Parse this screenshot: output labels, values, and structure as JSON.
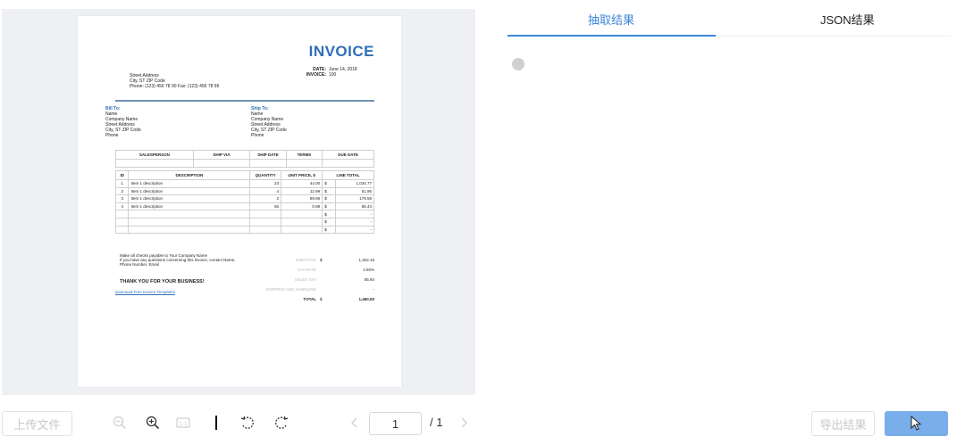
{
  "toolbar": {
    "upload_label": "上传文件",
    "page_current": "1",
    "page_total": "/ 1",
    "icons": [
      "zoom-out-icon",
      "zoom-in-icon",
      "fit-page-icon",
      "divider-icon",
      "rotate-left-icon",
      "rotate-right-icon",
      "prev-page-icon",
      "next-page-icon"
    ]
  },
  "tabs": {
    "extract": "抽取结果",
    "json": "JSON结果"
  },
  "actions": {
    "export_label": "导出结果"
  },
  "colors": {
    "accent": "#3e86d9",
    "primary_button": "#7aaeea",
    "invoice_blue": "#2f6fb5"
  },
  "invoice": {
    "title": "INVOICE",
    "date_label": "DATE:",
    "date_value": "June 14, 2018",
    "invoice_label": "INVOICE:",
    "invoice_value": "100",
    "address": [
      "Street Address",
      "City, ST  ZIP Code",
      "Phone: (123) 456 78 90   Fax: (123) 456 78 96"
    ],
    "bill_to": {
      "heading": "Bill To:",
      "lines": [
        "Name",
        "Company Name",
        "Street Address",
        "City, ST  ZIP Code",
        "Phone"
      ]
    },
    "ship_to": {
      "heading": "Ship To:",
      "lines": [
        "Name",
        "Company Name",
        "Street Address",
        "City, ST  ZIP Code",
        "Phone"
      ]
    },
    "ship_headers": [
      "SALESPERSON",
      "SHIP VIA",
      "SHIP DATE",
      "TERMS",
      "DUE DATE"
    ],
    "item_headers": [
      "ID",
      "DESCRIPTION",
      "QUANTITY",
      "UNIT PRICE, $",
      "LINE TOTAL"
    ],
    "items": [
      {
        "id": "1",
        "desc": "Item 1 description",
        "qty": "23",
        "price": "44.00",
        "cur": "$",
        "total": "1,034.77"
      },
      {
        "id": "2",
        "desc": "Item 1 description",
        "qty": "4",
        "price": "12.99",
        "cur": "$",
        "total": "51.96"
      },
      {
        "id": "3",
        "desc": "Item 1 description",
        "qty": "2",
        "price": "89.96",
        "cur": "$",
        "total": "179.58"
      },
      {
        "id": "4",
        "desc": "Item 1 description",
        "qty": "56",
        "price": "0.98",
        "cur": "$",
        "total": "55.44"
      },
      {
        "id": "",
        "desc": "",
        "qty": "",
        "price": "",
        "cur": "$",
        "total": "-"
      },
      {
        "id": "",
        "desc": "",
        "qty": "",
        "price": "",
        "cur": "$",
        "total": "-"
      },
      {
        "id": "",
        "desc": "",
        "qty": "",
        "price": "",
        "cur": "$",
        "total": "-"
      }
    ],
    "note_lines": [
      "Make all checks payable to Your Company Name",
      "If you have any questions concerning this invoice, contact Name,",
      "Phone Number, Email"
    ],
    "thanks": "THANK YOU FOR YOUR BUSINESS!",
    "download_link": "download Free Invoice Templates",
    "summary": [
      {
        "label": "SUBTOTAL",
        "cur": "$",
        "value": "1,322.15"
      },
      {
        "label": "TAX RATE",
        "cur": "",
        "value": "4.50%"
      },
      {
        "label": "SALES TAX",
        "cur": "",
        "value": "65.94"
      },
      {
        "label": "SHIPPING AND HANDLING",
        "cur": "",
        "value": "-"
      },
      {
        "label": "TOTAL",
        "cur": "$",
        "value": "1,460.00"
      }
    ]
  }
}
